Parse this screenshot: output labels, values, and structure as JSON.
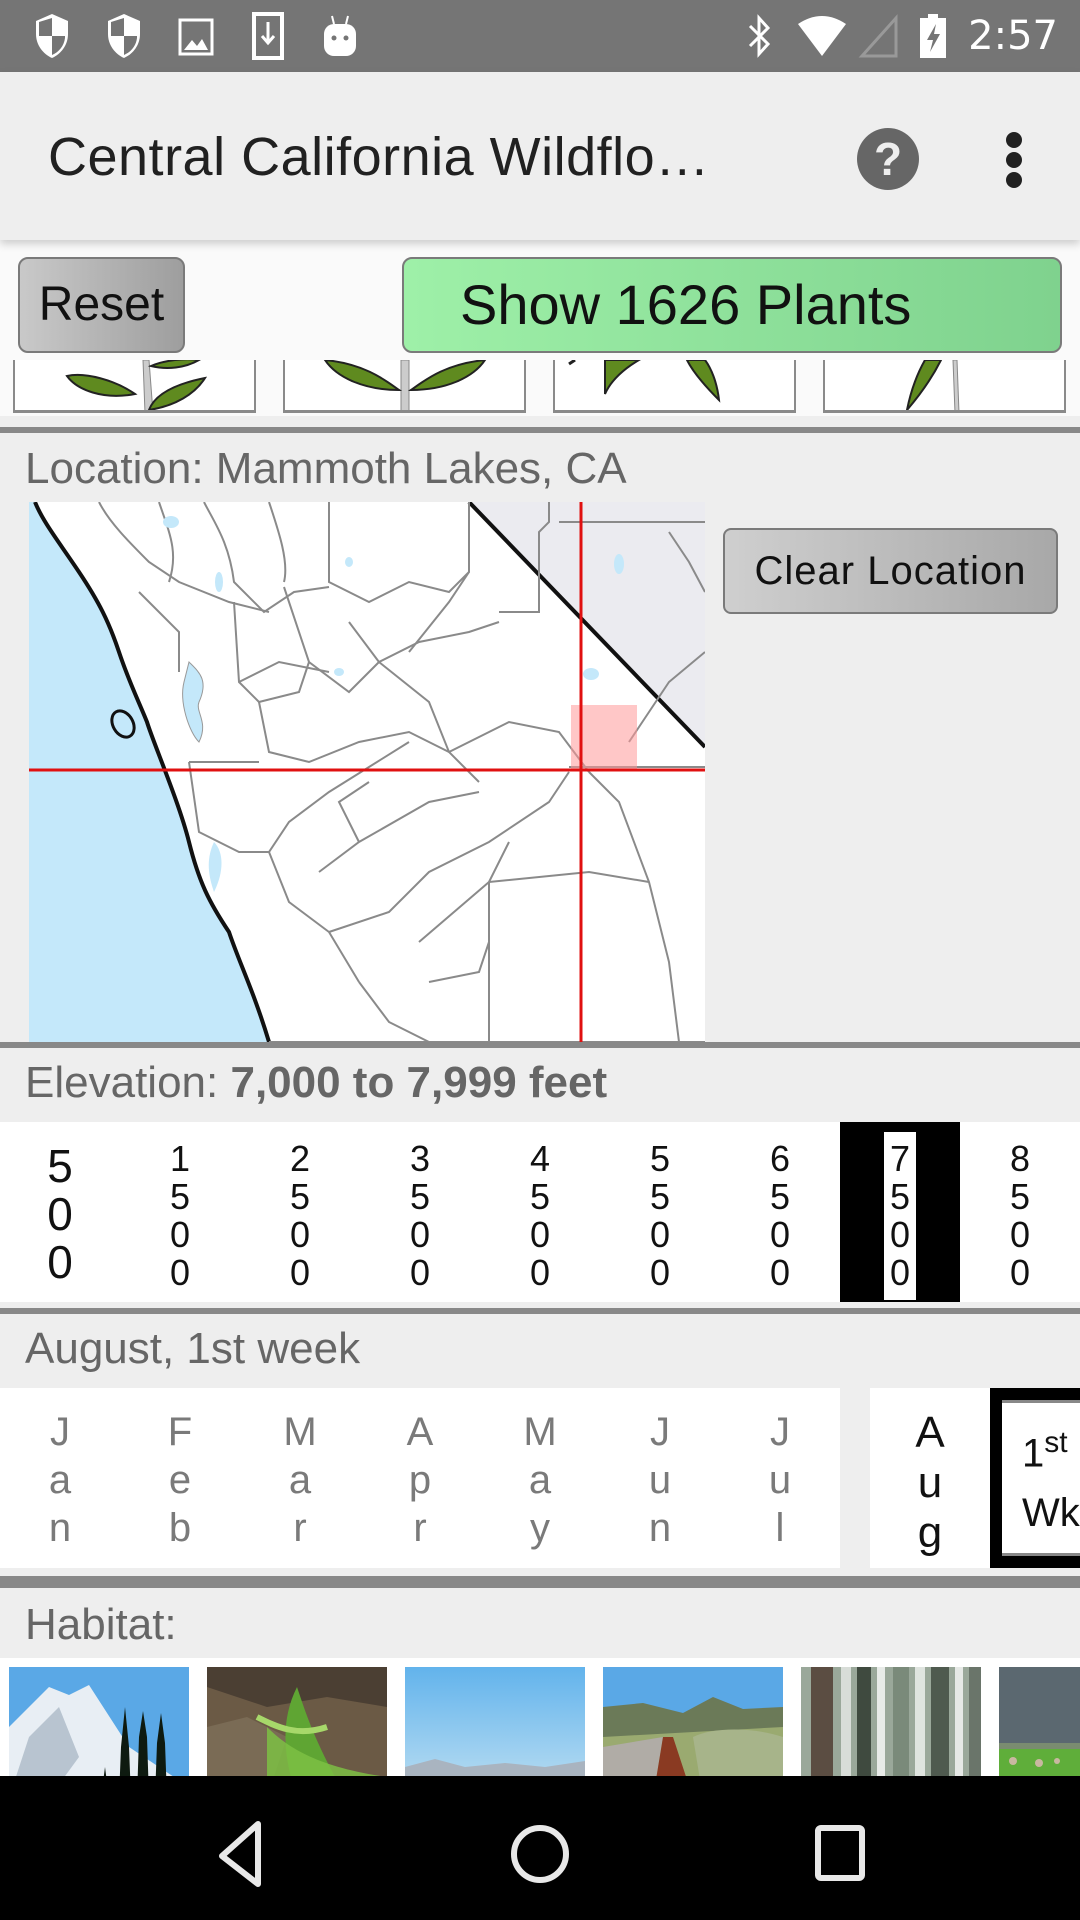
{
  "status_bar": {
    "time": "2:57",
    "left_icons": [
      "shield-icon",
      "shield-icon",
      "image-icon",
      "download-icon",
      "android-icon"
    ],
    "right_icons": [
      "bluetooth-icon",
      "wifi-icon",
      "cell-signal-icon",
      "battery-charging-icon"
    ]
  },
  "app_bar": {
    "title": "Central California Wildflo…",
    "help_icon_label": "?",
    "overflow_icon": "more-vert-icon"
  },
  "buttons": {
    "reset_label": "Reset",
    "show_plants_label": "Show 1626 Plants",
    "clear_location_label": "Clear Location"
  },
  "colors": {
    "show_plants_green": "#8fe09c",
    "crosshair_red": "#e01010",
    "water_blue": "#c4e8fa"
  },
  "leaf_arrangement": {
    "tiles": [
      "alternate-leaves",
      "opposite-leaves",
      "whorled-leaves",
      "basal-leaves"
    ]
  },
  "location": {
    "label": "Location:",
    "value": "Mammoth Lakes, CA",
    "full_text": "Location: Mammoth Lakes, CA"
  },
  "elevation": {
    "label": "Elevation:",
    "value": "7,000 to 7,999 feet",
    "options": [
      "500",
      "1500",
      "2500",
      "3500",
      "4500",
      "5500",
      "6500",
      "7500",
      "8500"
    ],
    "selected": "7500"
  },
  "season": {
    "label": "August, 1st week",
    "months": [
      "Jan",
      "Feb",
      "Mar",
      "Apr",
      "May",
      "Jun",
      "Jul"
    ],
    "selected_month": "Aug",
    "selected_week_num": "1",
    "selected_week_suffix": "st",
    "selected_week_label": "Wk"
  },
  "habitat": {
    "label": "Habitat:",
    "tiles": [
      "alpine-mountains",
      "rock-ferns",
      "desert-valley",
      "scrub-roadside",
      "forest-trunks",
      "grassland-storm"
    ]
  },
  "nav_bar": {
    "back": "back-icon",
    "home": "home-icon",
    "recents": "recents-icon"
  }
}
